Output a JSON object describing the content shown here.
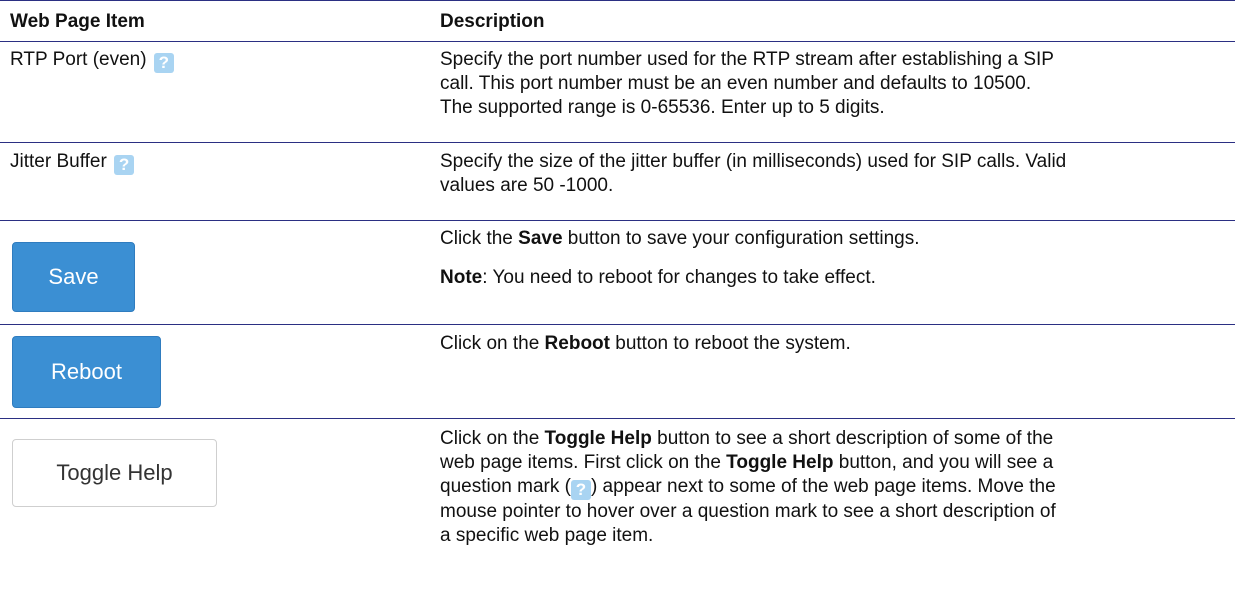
{
  "headers": {
    "item": "Web Page Item",
    "description": "Description"
  },
  "rows": [
    {
      "item_label": "RTP Port (even)",
      "help_icon": "question-mark-icon",
      "description": [
        "Specify the port number used for the RTP stream after establishing a SIP",
        "call. This port number must be an even number and defaults to 10500.",
        "The supported range is 0-65536. Enter up to 5 digits."
      ]
    },
    {
      "item_label": "Jitter Buffer",
      "help_icon": "question-mark-icon",
      "description": [
        "Specify the size of the jitter buffer (in milliseconds) used for SIP calls. Valid",
        "values are 50 -1000."
      ]
    },
    {
      "button_label": "Save",
      "desc_pre": "Click the ",
      "desc_bold": "Save",
      "desc_post": " button to save your configuration settings.",
      "note_bold": "Note",
      "note_text": ": You need to reboot for changes to take effect."
    },
    {
      "button_label": "Reboot",
      "desc_pre": "Click on the ",
      "desc_bold": "Reboot",
      "desc_post": " button to reboot the system."
    },
    {
      "button_label": "Toggle Help",
      "line1_pre": "Click on the ",
      "line1_bold": "Toggle Help",
      "line1_post": " button to see a short description of some of the",
      "line2_pre": "web page items. First click on the ",
      "line2_bold": "Toggle Help",
      "line2_post": " button, and you will see a",
      "line3_pre": "question mark (",
      "line3_post": ") appear next to some of the web page items. Move the",
      "line4": "mouse pointer to hover over a question mark to see a short description of",
      "line5": "a specific web page item."
    }
  ],
  "help_glyph": "?",
  "colors": {
    "rule": "#2b2f83",
    "button_blue": "#3b8fd3",
    "help_icon_bg": "#a9d4f2"
  }
}
